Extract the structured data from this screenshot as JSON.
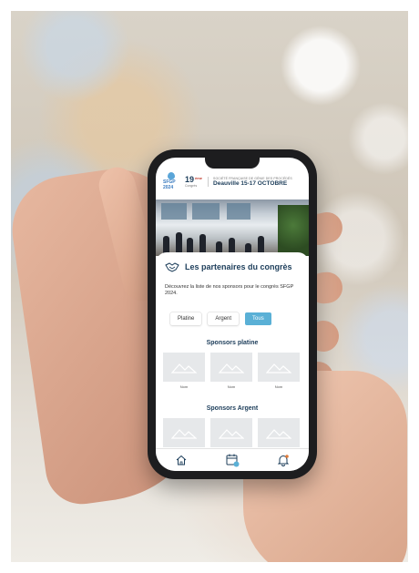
{
  "colors": {
    "accent": "#5ab0d6",
    "navy": "#1c3d5a",
    "placeholder": "#e6e8ea"
  },
  "header": {
    "logo_text": "SFGP 2024",
    "edition_number": "19",
    "edition_suffix": "ème",
    "edition_word": "Congrès",
    "organization": "SOCIÉTÉ FRANÇAISE DE GÉNIE DES PROCÉDÉS",
    "location_dates": "Deauville 15-17 OCTOBRE"
  },
  "partners": {
    "icon": "handshake-icon",
    "title": "Les partenaires du congrès",
    "description": "Découvrez la liste de nos sponsors pour le congrès SFGP 2024.",
    "filters": [
      {
        "label": "Platine",
        "active": false
      },
      {
        "label": "Argent",
        "active": false
      },
      {
        "label": "Tous",
        "active": true
      }
    ]
  },
  "sections": [
    {
      "title": "Sponsors platine",
      "items": [
        {
          "name": "Nom"
        },
        {
          "name": "Nom"
        },
        {
          "name": "Nom"
        }
      ]
    },
    {
      "title": "Sponsors Argent",
      "items": [
        {
          "name": ""
        },
        {
          "name": ""
        },
        {
          "name": ""
        }
      ]
    }
  ],
  "tabbar": {
    "tabs": [
      {
        "icon": "home-icon"
      },
      {
        "icon": "calendar-icon"
      },
      {
        "icon": "bell-icon"
      }
    ]
  }
}
